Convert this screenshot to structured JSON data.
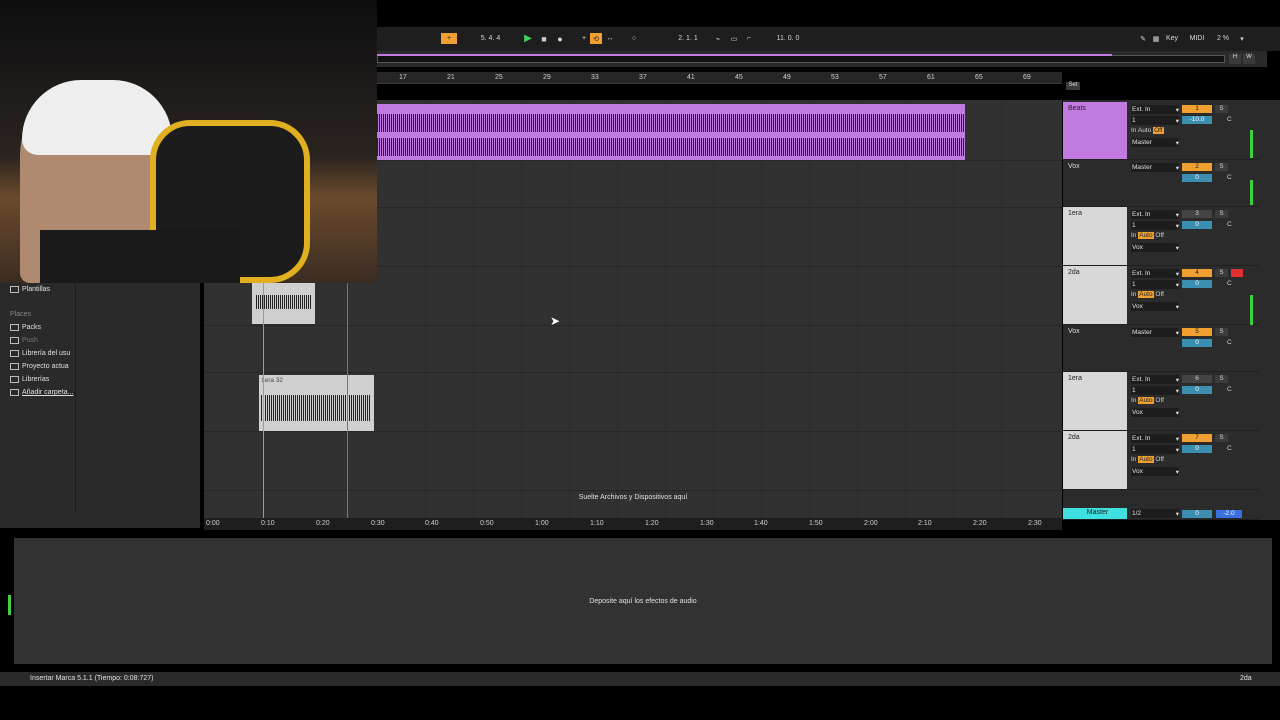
{
  "transport": {
    "position": "5.  4.  4",
    "loop_start": "2.  1.  1",
    "loop_length": "11.  0.  0",
    "key_label": "Key",
    "midi_label": "MIDI",
    "cpu": "2 %",
    "h_label": "H",
    "w_label": "W"
  },
  "ruler": {
    "bars": [
      "17",
      "21",
      "25",
      "29",
      "33",
      "37",
      "41",
      "45",
      "49",
      "53",
      "57",
      "61",
      "65",
      "69"
    ]
  },
  "set_label": "Set",
  "browser": {
    "plantillas": "Plantillas",
    "places_header": "Places",
    "items": [
      "Packs",
      "Push",
      "Librería del usu",
      "Proyecto actua",
      "Librerías",
      "Añadir carpeta..."
    ]
  },
  "arrangement": {
    "clip_label": "1era 32",
    "drop_hint": "Suelte Archivos y Dispositivos aquí"
  },
  "time_ruler": [
    "0:00",
    "0:10",
    "0:20",
    "0:30",
    "0:40",
    "0:50",
    "1:00",
    "1:10",
    "1:20",
    "1:30",
    "1:40",
    "1:50",
    "2:00",
    "2:10",
    "2:20",
    "2:30"
  ],
  "tracks": [
    {
      "name": "Beats",
      "input": "Ext. In",
      "channel": "1",
      "out": "Master",
      "num": "1",
      "vol": "-10.0",
      "pan": "C",
      "color": "#c17be0"
    },
    {
      "name": "Vox",
      "out": "Master",
      "num": "2",
      "vol": "0",
      "pan": "C",
      "color": "#d8d8d8"
    },
    {
      "name": "1era",
      "input": "Ext. In",
      "channel": "1",
      "out": "Vox",
      "num": "3",
      "vol": "0",
      "pan": "C",
      "color": "#d8d8d8"
    },
    {
      "name": "2da",
      "input": "Ext. In",
      "channel": "1",
      "out": "Vox",
      "num": "4",
      "vol": "0",
      "pan": "C",
      "color": "#d8d8d8"
    },
    {
      "name": "Vox",
      "out": "Master",
      "num": "5",
      "vol": "0",
      "pan": "C",
      "color": "#d8d8d8"
    },
    {
      "name": "1era",
      "input": "Ext. In",
      "channel": "1",
      "out": "Vox",
      "num": "6",
      "vol": "0",
      "pan": "C",
      "color": "#d8d8d8"
    },
    {
      "name": "2da",
      "input": "Ext. In",
      "channel": "1",
      "out": "Vox",
      "num": "7",
      "vol": "0",
      "pan": "C",
      "color": "#d8d8d8"
    }
  ],
  "monitor": {
    "in": "In",
    "auto": "Auto",
    "off": "Off"
  },
  "master": {
    "name": "Master",
    "channel": "1/2",
    "vol": "0",
    "gain": "-2.0"
  },
  "solo": "S",
  "device_hint": "Deposite aquí los efectos de audio",
  "status_text": "Insertar Marca 5.1.1 (Tiempo: 0:08:727)",
  "selected_track": "2da"
}
